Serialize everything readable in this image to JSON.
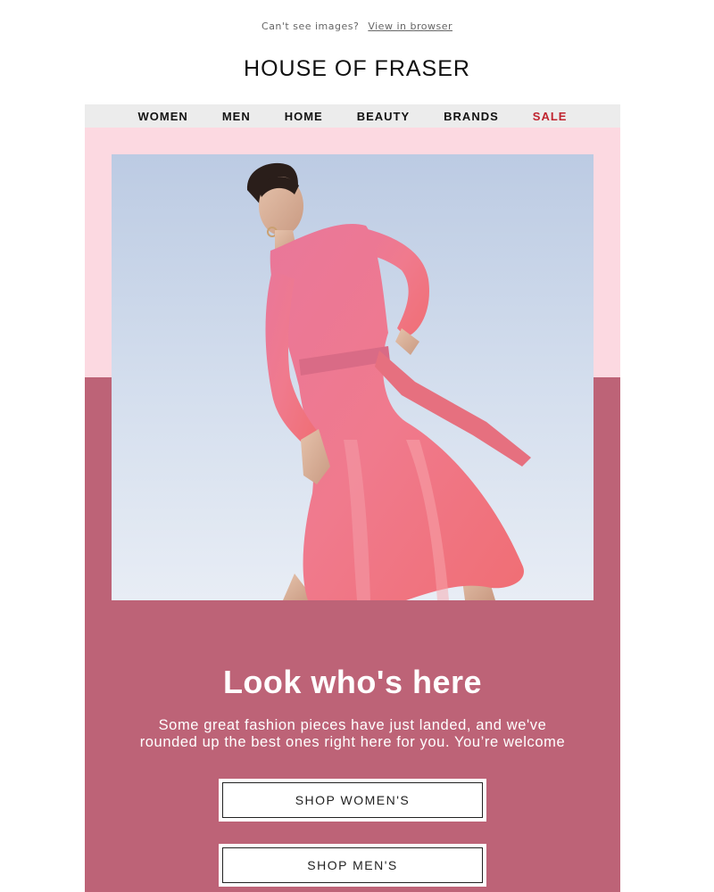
{
  "preheader": {
    "text": "Can't see images?",
    "link": "View in browser"
  },
  "brand": {
    "logo": "HOUSE OF FRASER"
  },
  "nav": {
    "items": [
      "WOMEN",
      "MEN",
      "HOME",
      "BEAUTY",
      "BRANDS"
    ],
    "sale": "SALE"
  },
  "hero": {
    "image": "woman-in-pink-satin-dress-photo"
  },
  "main": {
    "headline": "Look who's here",
    "body": "Some great fashion pieces have just landed, and we've rounded up the best ones right here for you. You’re welcome"
  },
  "cta": {
    "women": "SHOP WOMEN'S",
    "men": "SHOP MEN'S"
  },
  "colors": {
    "pink_background": "#fcd9e1",
    "rose_background": "#bd6377",
    "sale_red": "#c0232e",
    "nav_background": "#ececec"
  }
}
